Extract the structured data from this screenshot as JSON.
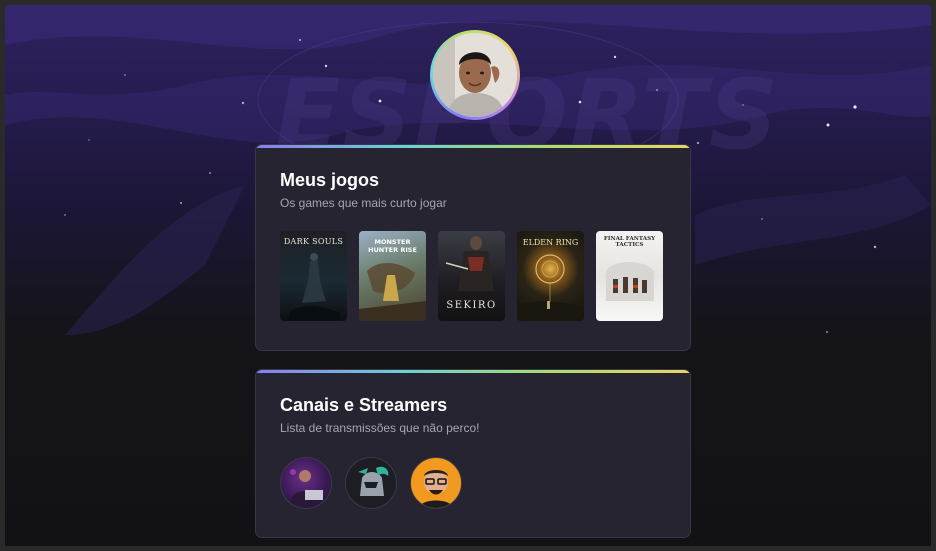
{
  "background": {
    "watermark_text": "ESPORTS"
  },
  "profile": {
    "avatar_icon": "profile-photo"
  },
  "games_card": {
    "title": "Meus jogos",
    "subtitle": "Os games que mais curto jogar",
    "games": [
      {
        "name": "DARK SOULS"
      },
      {
        "name": "MONSTER HUNTER RISE"
      },
      {
        "name": "SEKIRO"
      },
      {
        "name": "ELDEN RING"
      },
      {
        "name": "FINAL FANTASY TACTICS"
      }
    ]
  },
  "streamers_card": {
    "title": "Canais e Streamers",
    "subtitle": "Lista de transmissões que não perco!",
    "streamers": [
      {
        "avatar_icon": "streamer-avatar-purple"
      },
      {
        "avatar_icon": "streamer-avatar-knight"
      },
      {
        "avatar_icon": "streamer-avatar-cartoon"
      }
    ]
  },
  "colors": {
    "card_background": "#262430",
    "gradient": [
      "#8a7cf2",
      "#6ad0d8",
      "#a9dd6f",
      "#e9d46a"
    ],
    "title": "#ffffff",
    "subtitle": "#a8a5b3"
  }
}
